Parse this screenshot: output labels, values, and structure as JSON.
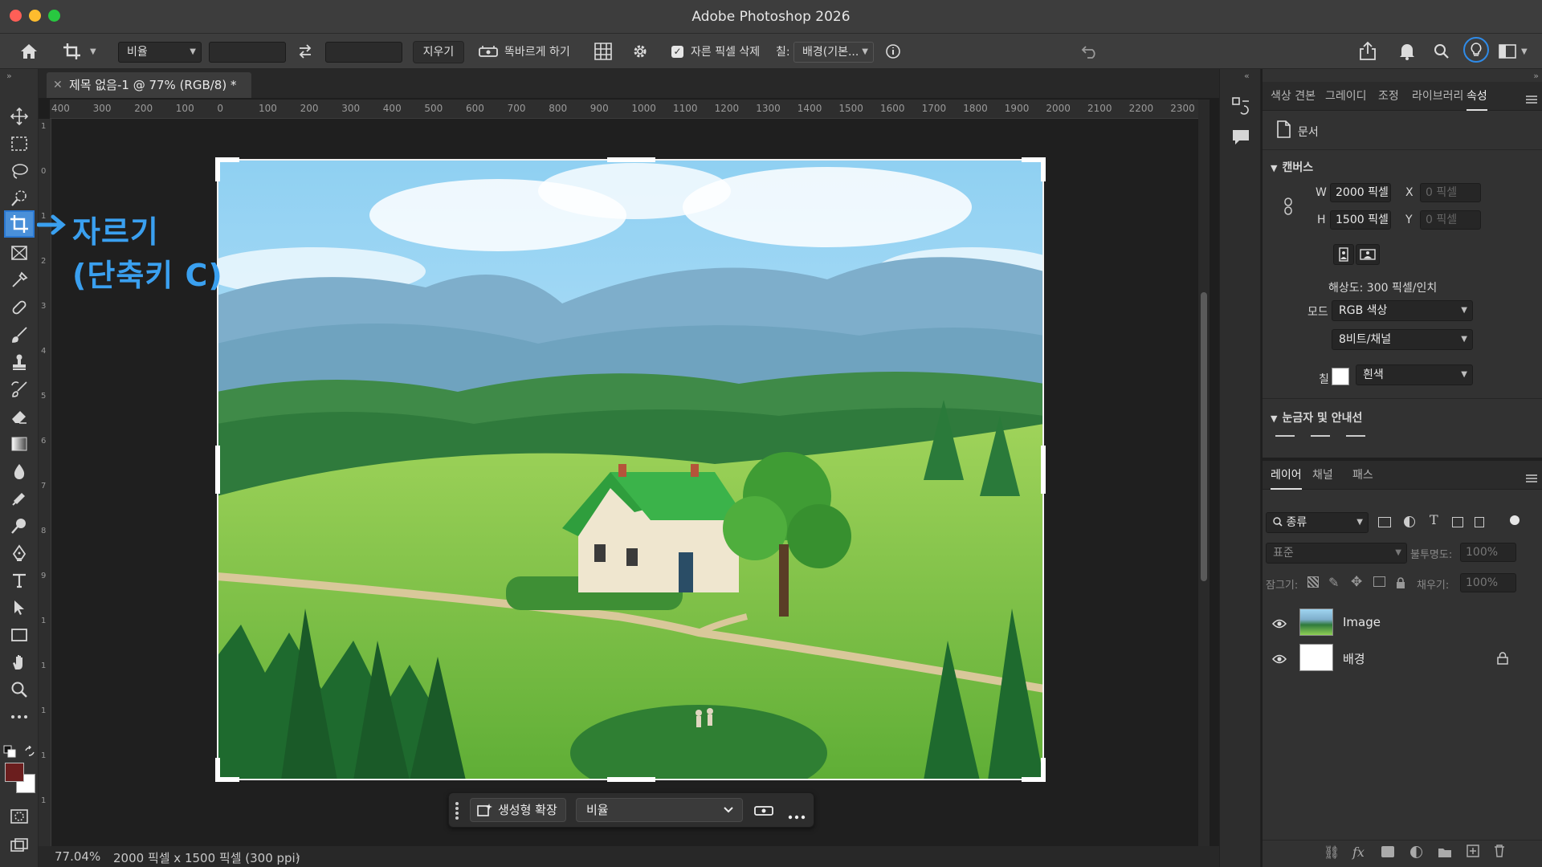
{
  "window": {
    "title": "Adobe Photoshop 2026"
  },
  "options": {
    "ratio_preset": "비율",
    "clear_label": "지우기",
    "straighten_label": "똑바르게 하기",
    "delete_cropped_label": "자른 픽셀 삭제",
    "delete_cropped_checked": true,
    "fill_label": "칠:",
    "fill_value": "배경(기본..."
  },
  "document": {
    "tab_title": "제목 없음-1 @ 77% (RGB/8) *"
  },
  "rulers": {
    "horizontal": [
      "400",
      "300",
      "200",
      "100",
      "0",
      "100",
      "200",
      "300",
      "400",
      "500",
      "600",
      "700",
      "800",
      "900",
      "1000",
      "1100",
      "1200",
      "1300",
      "1400",
      "1500",
      "1600",
      "1700",
      "1800",
      "1900",
      "2000",
      "2100",
      "2200",
      "2300"
    ],
    "vertical": [
      "1",
      "0",
      "1",
      "2",
      "3",
      "4",
      "5",
      "6",
      "7",
      "8",
      "9",
      "1",
      "1",
      "1",
      "1",
      "1"
    ]
  },
  "annotation": {
    "line1": "자르기",
    "line2": "(단축키 C)"
  },
  "contextual_bar": {
    "generate_label": "생성형 확장",
    "ratio_value": "비율"
  },
  "status": {
    "zoom": "77.04%",
    "doc_info": "2000 픽셀 x 1500 픽셀 (300 ppi)"
  },
  "properties_panel": {
    "tabs": [
      "색상 견본",
      "그레이디",
      "조정",
      "라이브러리",
      "속성"
    ],
    "active_tab": "속성",
    "doc_label": "문서",
    "canvas_section": "캔버스",
    "w_label": "W",
    "w_value": "2000 픽셀",
    "h_label": "H",
    "h_value": "1500 픽셀",
    "x_label": "X",
    "x_placeholder": "0 픽셀",
    "y_label": "Y",
    "y_placeholder": "0 픽셀",
    "resolution": "해상도: 300 픽셀/인치",
    "mode_label": "모드",
    "mode_value": "RGB 색상",
    "depth_value": "8비트/채널",
    "fill_label": "칠",
    "fill_value": "흰색",
    "rulers_section": "눈금자 및 안내선"
  },
  "layers_panel": {
    "tabs": [
      "레이어",
      "채널",
      "패스"
    ],
    "active_tab": "레이어",
    "filter_label": "종류",
    "blend_mode": "표준",
    "opacity_label": "불투명도:",
    "opacity_value": "100%",
    "lock_label": "잠그기:",
    "fill_label": "채우기:",
    "fill_value": "100%",
    "layers": [
      {
        "name": "Image",
        "visible": true,
        "locked": false
      },
      {
        "name": "배경",
        "visible": true,
        "locked": true
      }
    ]
  },
  "colors": {
    "accent": "#3aa0f0",
    "foreground": "#6b1e1e",
    "background": "#ffffff"
  }
}
